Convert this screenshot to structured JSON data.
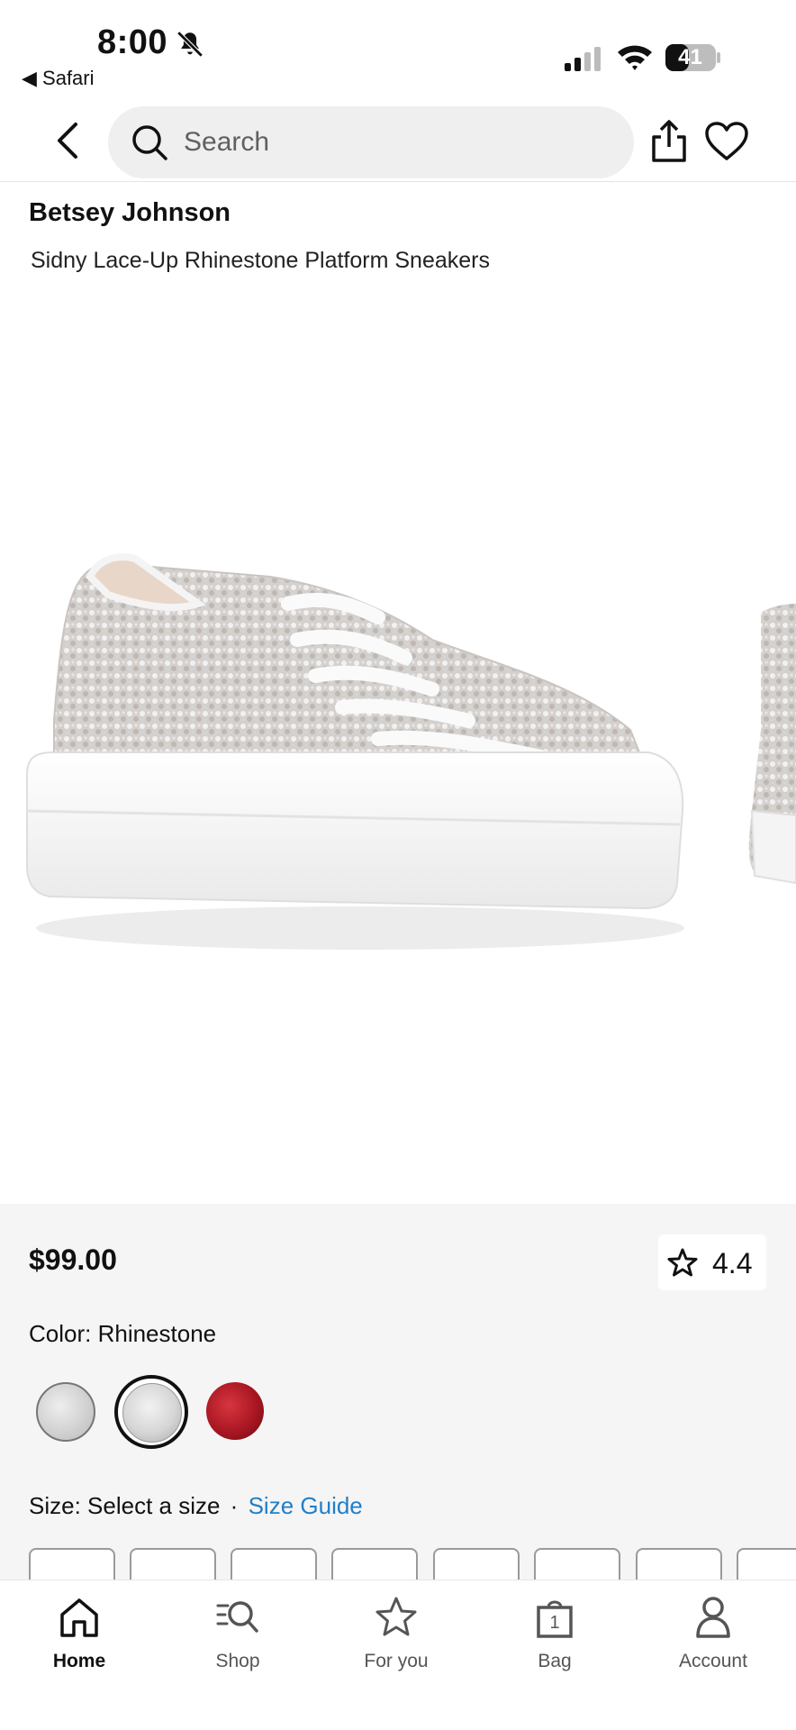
{
  "status_bar": {
    "time": "8:00",
    "back_app": "Safari",
    "battery": "41"
  },
  "header": {
    "search_placeholder": "Search"
  },
  "product": {
    "brand": "Betsey Johnson",
    "name": "Sidny Lace-Up Rhinestone Platform Sneakers",
    "price": "$99.00",
    "rating": "4.4"
  },
  "color": {
    "label": "Color: Rhinestone"
  },
  "size": {
    "label": "Size: Select a size",
    "separator": "·",
    "guide": "Size Guide"
  },
  "bottom_nav": {
    "items": [
      {
        "label": "Home",
        "icon": "home-icon",
        "active": true
      },
      {
        "label": "Shop",
        "icon": "shop-search-icon",
        "active": false
      },
      {
        "label": "For you",
        "icon": "star-icon",
        "active": false
      },
      {
        "label": "Bag",
        "icon": "bag-icon",
        "badge": "1",
        "active": false
      },
      {
        "label": "Account",
        "icon": "account-icon",
        "active": false
      }
    ]
  },
  "colors": {
    "accent_link": "#1f7fc9",
    "panel_bg": "#f5f5f5"
  }
}
